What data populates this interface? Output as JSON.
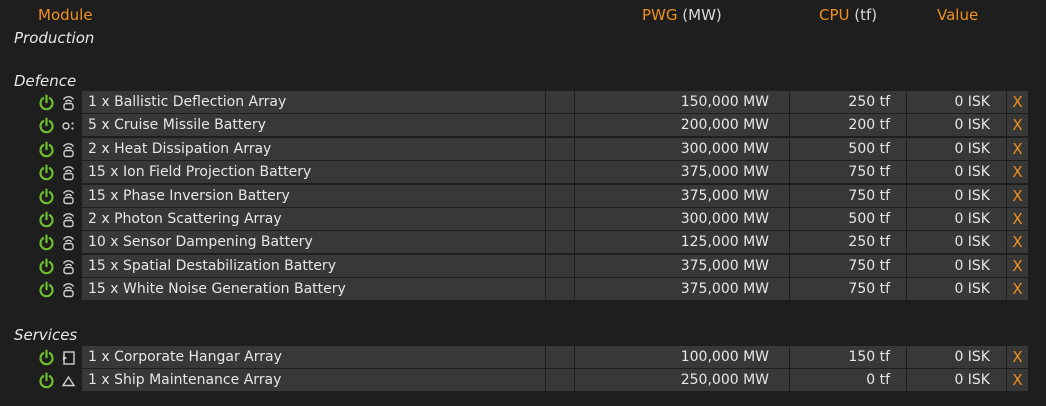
{
  "header": {
    "module": "Module",
    "pwg": "PWG",
    "pwg_unit": "(MW)",
    "cpu": "CPU",
    "cpu_unit": "(tf)",
    "value": "Value",
    "production": "Production"
  },
  "groups": [
    {
      "name": "Defence",
      "items": [
        {
          "label": "1 x Ballistic Deflection Array",
          "pwg": "150,000 MW",
          "cpu": "250 tf",
          "value": "0 ISK",
          "state": "online"
        },
        {
          "label": "5 x Cruise Missile Battery",
          "pwg": "200,000 MW",
          "cpu": "200 tf",
          "value": "0 ISK",
          "state": "target"
        },
        {
          "label": "2 x Heat Dissipation Array",
          "pwg": "300,000 MW",
          "cpu": "500 tf",
          "value": "0 ISK",
          "state": "online"
        },
        {
          "label": "15 x Ion Field Projection Battery",
          "pwg": "375,000 MW",
          "cpu": "750 tf",
          "value": "0 ISK",
          "state": "online"
        },
        {
          "label": "15 x Phase Inversion Battery",
          "pwg": "375,000 MW",
          "cpu": "750 tf",
          "value": "0 ISK",
          "state": "online"
        },
        {
          "label": "2 x Photon Scattering Array",
          "pwg": "300,000 MW",
          "cpu": "500 tf",
          "value": "0 ISK",
          "state": "online"
        },
        {
          "label": "10 x Sensor Dampening Battery",
          "pwg": "125,000 MW",
          "cpu": "250 tf",
          "value": "0 ISK",
          "state": "online"
        },
        {
          "label": "15 x Spatial Destabilization Battery",
          "pwg": "375,000 MW",
          "cpu": "750 tf",
          "value": "0 ISK",
          "state": "online"
        },
        {
          "label": "15 x White Noise Generation Battery",
          "pwg": "375,000 MW",
          "cpu": "750 tf",
          "value": "0 ISK",
          "state": "online"
        }
      ]
    },
    {
      "name": "Services",
      "items": [
        {
          "label": "1 x Corporate Hangar Array",
          "pwg": "100,000 MW",
          "cpu": "150 tf",
          "value": "0 ISK",
          "state": "hangar"
        },
        {
          "label": "1 x Ship Maintenance Array",
          "pwg": "250,000 MW",
          "cpu": "0 tf",
          "value": "0 ISK",
          "state": "ship"
        }
      ]
    }
  ],
  "delete_label": "X",
  "colors": {
    "accent": "#f0901e",
    "power": "#6dbf2f",
    "row_bg": "#383838",
    "page_bg": "#1e1e1e"
  }
}
